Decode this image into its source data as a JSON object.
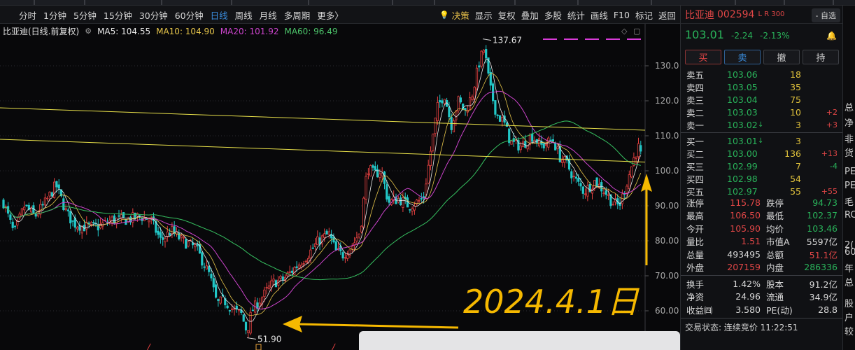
{
  "toolbar": {
    "periods": [
      "分时",
      "1分钟",
      "5分钟",
      "15分钟",
      "30分钟",
      "60分钟",
      "日线",
      "周线",
      "月线",
      "多周期",
      "更多〉"
    ],
    "active_period": "日线",
    "right_items": [
      "决策",
      "显示",
      "复权",
      "叠加",
      "多股",
      "统计",
      "画线",
      "F10",
      "标记",
      "返回"
    ]
  },
  "chart": {
    "title": "比亚迪(日线.前复权)",
    "ma": [
      {
        "label": "MA5: 104.55",
        "color": "#e8e8e8"
      },
      {
        "label": "MA10: 104.90",
        "color": "#e6c54a"
      },
      {
        "label": "MA20: 101.92",
        "color": "#cc44cc"
      },
      {
        "label": "MA60: 96.49",
        "color": "#4cc46a"
      }
    ],
    "y_ticks": [
      "130.0",
      "120.0",
      "110.0",
      "100.0",
      "90.00",
      "80.00",
      "70.00",
      "60.00"
    ],
    "high_label": "137.67",
    "low_label": "51.90",
    "annotation": "2024.4.1日"
  },
  "stock": {
    "name": "比亚迪",
    "code": "002594",
    "tag": "L R 300",
    "self_select": "- 自选",
    "last": "103.01",
    "change": "-2.24",
    "change_pct": "-2.13%"
  },
  "trade_buttons": [
    "买",
    "卖",
    "撤",
    "持"
  ],
  "orderbook": {
    "asks": [
      {
        "label": "卖五",
        "price": "103.06",
        "vol": "18",
        "chg": ""
      },
      {
        "label": "卖四",
        "price": "103.05",
        "vol": "35",
        "chg": ""
      },
      {
        "label": "卖三",
        "price": "103.04",
        "vol": "75",
        "chg": ""
      },
      {
        "label": "卖二",
        "price": "103.03",
        "vol": "10",
        "chg": "+2"
      },
      {
        "label": "卖一",
        "price": "103.02",
        "vol": "3",
        "chg": "+3"
      }
    ],
    "bids": [
      {
        "label": "买一",
        "price": "103.01",
        "vol": "3",
        "chg": ""
      },
      {
        "label": "买二",
        "price": "103.00",
        "vol": "136",
        "chg": "+13"
      },
      {
        "label": "买三",
        "price": "102.99",
        "vol": "7",
        "chg": "-4"
      },
      {
        "label": "买四",
        "price": "102.98",
        "vol": "54",
        "chg": ""
      },
      {
        "label": "买五",
        "price": "102.97",
        "vol": "55",
        "chg": "+55"
      }
    ]
  },
  "stats": {
    "group1": [
      {
        "l1": "涨停",
        "v1": "115.78",
        "c1": "red",
        "l2": "跌停",
        "v2": "94.73",
        "c2": "grn"
      },
      {
        "l1": "最高",
        "v1": "106.50",
        "c1": "red",
        "l2": "最低",
        "v2": "102.37",
        "c2": "grn"
      },
      {
        "l1": "今开",
        "v1": "105.90",
        "c1": "red",
        "l2": "均价",
        "v2": "103.46",
        "c2": "grn"
      },
      {
        "l1": "量比",
        "v1": "1.51",
        "c1": "red",
        "l2": "市值A",
        "v2": "5597亿",
        "c2": "neutral"
      },
      {
        "l1": "总量",
        "v1": "493495",
        "c1": "neutral",
        "l2": "总额",
        "v2": "51.1亿",
        "c2": "red"
      },
      {
        "l1": "外盘",
        "v1": "207159",
        "c1": "red",
        "l2": "内盘",
        "v2": "286336",
        "c2": "grn"
      }
    ],
    "group2": [
      {
        "l1": "换手",
        "v1": "1.42%",
        "c1": "neutral",
        "l2": "股本",
        "v2": "91.2亿",
        "c2": "neutral"
      },
      {
        "l1": "净资",
        "v1": "24.96",
        "c1": "neutral",
        "l2": "流通",
        "v2": "34.9亿",
        "c2": "neutral"
      },
      {
        "l1": "收益㈣",
        "v1": "3.580",
        "c1": "neutral",
        "l2": "PE(动)",
        "v2": "28.8",
        "c2": "neutral"
      }
    ]
  },
  "trade_state": "交易状态: 连续竞价 11:22:51",
  "edge_chars": [
    "总",
    "净",
    "非",
    "货",
    "PE",
    "PE",
    "毛",
    "RC",
    "2(",
    "60",
    "年",
    "总",
    "股",
    "户",
    "较"
  ]
}
